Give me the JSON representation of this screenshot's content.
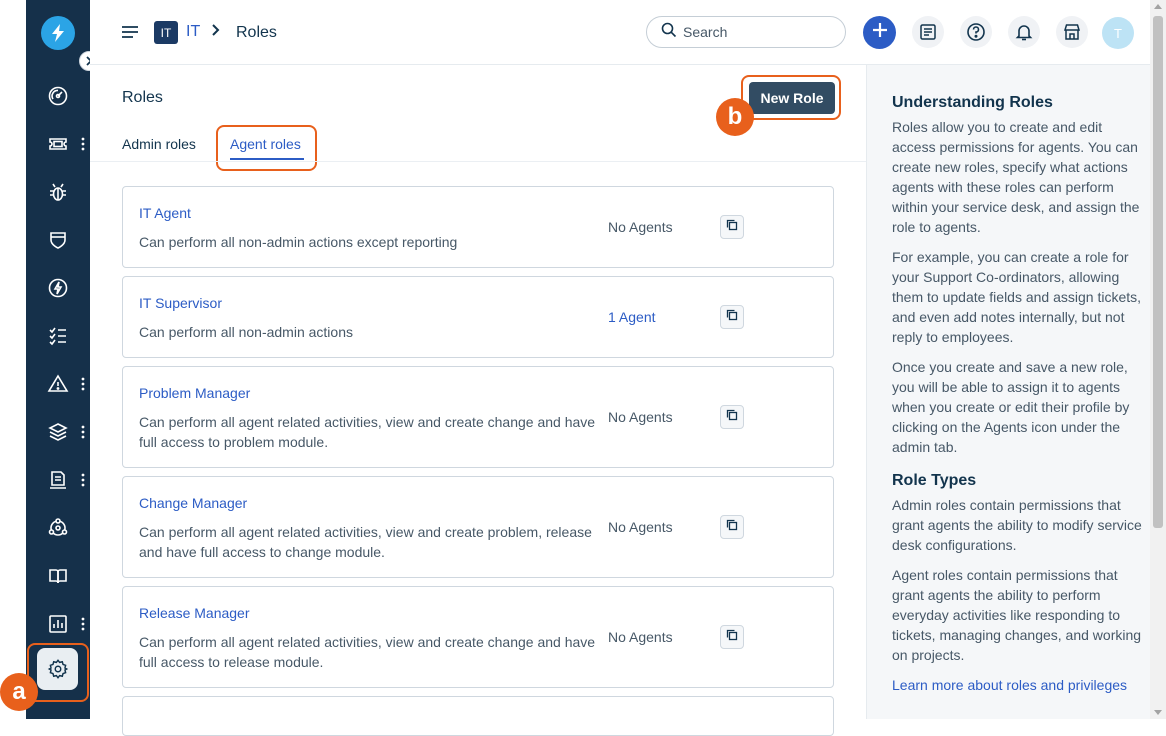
{
  "sidebar": {
    "items": [
      {
        "icon": "dashboard-icon"
      },
      {
        "icon": "ticket-icon",
        "has_menu": true
      },
      {
        "icon": "bug-icon"
      },
      {
        "icon": "shield-icon"
      },
      {
        "icon": "bolt-icon"
      },
      {
        "icon": "checklist-icon"
      },
      {
        "icon": "warning-icon",
        "has_menu": true
      },
      {
        "icon": "layers-icon",
        "has_menu": true
      },
      {
        "icon": "document-icon",
        "has_menu": true
      },
      {
        "icon": "network-icon"
      },
      {
        "icon": "book-icon"
      },
      {
        "icon": "analytics-icon",
        "has_menu": true
      },
      {
        "icon": "settings-icon",
        "active": true
      }
    ],
    "annotation_a": "a"
  },
  "header": {
    "workspace_badge": "IT",
    "breadcrumb_parent": "IT",
    "breadcrumb_separator": ">",
    "breadcrumb_current": "Roles",
    "search_placeholder": "Search",
    "avatar_initial": "T"
  },
  "main": {
    "title": "Roles",
    "new_role_label": "New Role",
    "annotation_b": "b",
    "tabs": [
      {
        "label": "Admin roles",
        "active": false
      },
      {
        "label": "Agent roles",
        "active": true
      }
    ],
    "roles": [
      {
        "name": "IT Agent",
        "description": "Can perform all non-admin actions except reporting",
        "agents": "No Agents",
        "agents_link": false
      },
      {
        "name": "IT Supervisor",
        "description": "Can perform all non-admin actions",
        "agents": "1 Agent",
        "agents_link": true
      },
      {
        "name": "Problem Manager",
        "description": "Can perform all agent related activities, view and create change and have full access to problem module.",
        "agents": "No Agents",
        "agents_link": false
      },
      {
        "name": "Change Manager",
        "description": "Can perform all agent related activities, view and create problem, release and have full access to change module.",
        "agents": "No Agents",
        "agents_link": false
      },
      {
        "name": "Release Manager",
        "description": "Can perform all agent related activities, view and create change and have full access to release module.",
        "agents": "No Agents",
        "agents_link": false
      }
    ]
  },
  "right_panel": {
    "heading1": "Understanding Roles",
    "p1": "Roles allow you to create and edit access permissions for agents. You can create new roles, specify what actions agents with these roles can perform within your service desk, and assign the role to agents.",
    "p2": "For example, you can create a role for your Support Co-ordinators, allowing them to update fields and assign tickets, and even add notes internally, but not reply to employees.",
    "p3": "Once you create and save a new role, you will be able to assign it to agents when you create or edit their profile by clicking on the Agents icon under the admin tab.",
    "heading2": "Role Types",
    "p4": "Admin roles contain permissions that grant agents the ability to modify service desk configurations.",
    "p5": "Agent roles contain permissions that grant agents the ability to perform everyday activities like responding to tickets, managing changes, and working on projects.",
    "link": "Learn more about roles and privileges"
  },
  "colors": {
    "sidebar_bg": "#15304a",
    "accent_blue": "#2c5cc5",
    "highlight_orange": "#e8601c",
    "primary_button": "#324c63"
  }
}
